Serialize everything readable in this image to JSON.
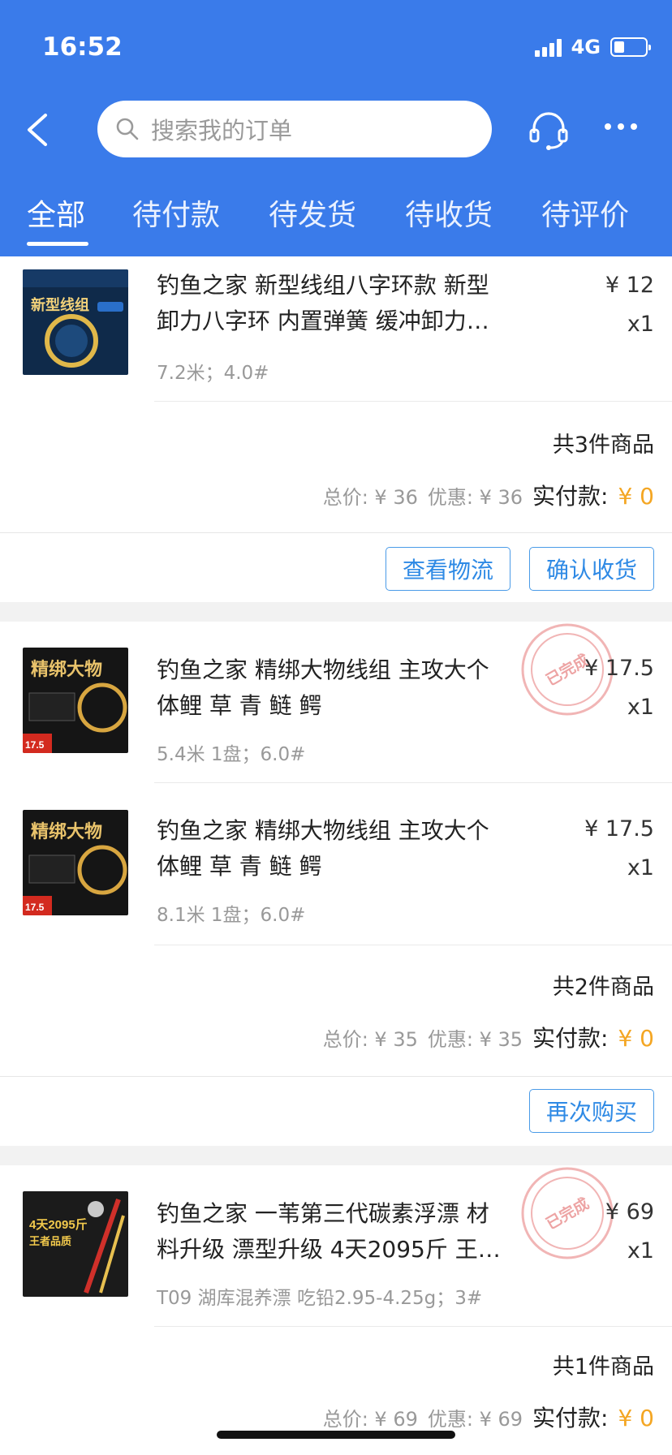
{
  "status": {
    "time": "16:52",
    "network": "4G"
  },
  "search": {
    "placeholder": "搜索我的订单"
  },
  "tabs": [
    "全部",
    "待付款",
    "待发货",
    "待收货",
    "待评价"
  ],
  "colors": {
    "brand": "#3a7bea",
    "accent_price": "#f4a623",
    "button_border": "#4a9be8",
    "stamp": "#e05a5a"
  },
  "orders": [
    {
      "items": [
        {
          "title_line1": "钓鱼之家 新型线组八字环款 新型",
          "title_line2": "卸力八字环  内置弹簧 缓冲卸力…",
          "spec": "7.2米；4.0#",
          "price": "¥ 12",
          "qty": "x1",
          "thumb_text": "新型线组"
        }
      ],
      "count": "共3件商品",
      "total_label": "总价: ¥ 36",
      "discount_label": "优惠: ¥ 36",
      "paid_label": "实付款:",
      "paid_value": "¥ 0",
      "buttons": [
        "查看物流",
        "确认收货"
      ]
    },
    {
      "stamp": "已完成",
      "items": [
        {
          "title_line1": "钓鱼之家 精绑大物线组  主攻大个",
          "title_line2": "体鲤 草 青 鲢 鳄",
          "spec": "5.4米 1盘；6.0#",
          "price": "¥ 17.5",
          "qty": "x1",
          "thumb_text": "精绑大物",
          "thumb_price": "17.5"
        },
        {
          "title_line1": "钓鱼之家 精绑大物线组  主攻大个",
          "title_line2": "体鲤 草 青 鲢 鳄",
          "spec": "8.1米 1盘；6.0#",
          "price": "¥ 17.5",
          "qty": "x1",
          "thumb_text": "精绑大物",
          "thumb_price": "17.5"
        }
      ],
      "count": "共2件商品",
      "total_label": "总价: ¥ 35",
      "discount_label": "优惠: ¥ 35",
      "paid_label": "实付款:",
      "paid_value": "¥ 0",
      "buttons": [
        "再次购买"
      ]
    },
    {
      "stamp": "已完成",
      "items": [
        {
          "title_line1": "钓鱼之家 一苇第三代碳素浮漂 材",
          "title_line2": "料升级 漂型升级 4天2095斤 王…",
          "spec": "T09 湖库混养漂 吃铅2.95-4.25g；3#",
          "price": "¥ 69",
          "qty": "x1",
          "thumb_text_line1": "4天2095斤",
          "thumb_text_line2": "王者品质"
        }
      ],
      "count": "共1件商品",
      "total_label": "总价: ¥ 69",
      "discount_label": "优惠: ¥ 69",
      "paid_label": "实付款:",
      "paid_value": "¥ 0"
    }
  ]
}
